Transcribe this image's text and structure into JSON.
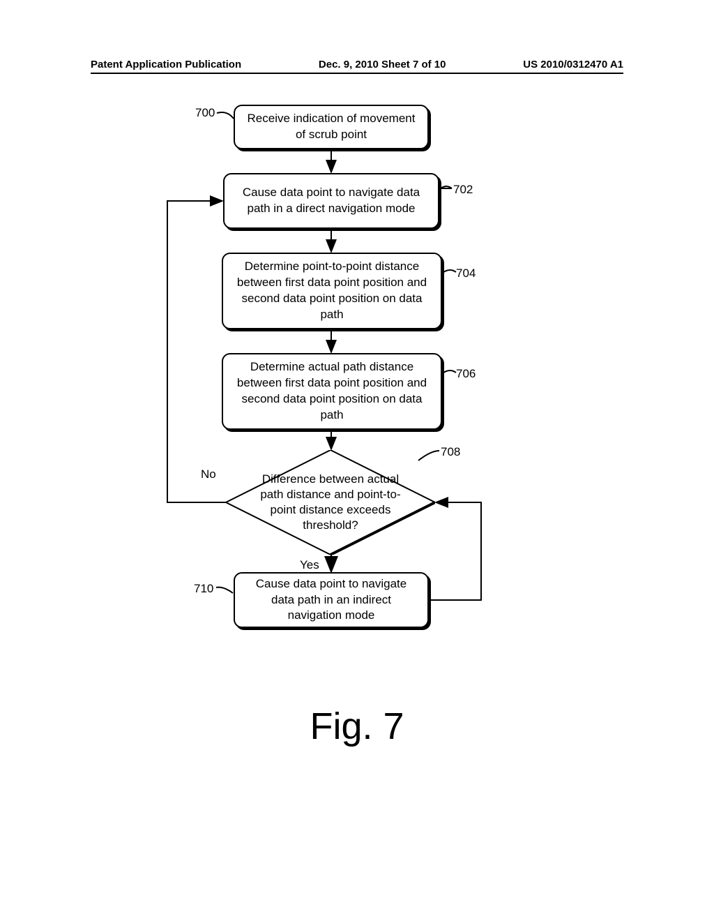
{
  "header": {
    "left": "Patent Application Publication",
    "center": "Dec. 9, 2010  Sheet 7 of 10",
    "right": "US 2010/0312470 A1"
  },
  "boxes": {
    "b700": "Receive indication of movement of scrub point",
    "b702": "Cause data point to navigate data path in a direct navigation mode",
    "b704": "Determine point-to-point distance between first data point position and second data point position on data path",
    "b706": "Determine actual path distance between first data point position and second data point position on data path",
    "b708": "Difference between actual path distance and point-to-point distance exceeds threshold?",
    "b710": "Cause data point to navigate data path in an indirect navigation mode"
  },
  "labels": {
    "l700": "700",
    "l702": "702",
    "l704": "704",
    "l706": "706",
    "l708": "708",
    "l710": "710",
    "no": "No",
    "yes": "Yes"
  },
  "figure_caption": "Fig. 7"
}
